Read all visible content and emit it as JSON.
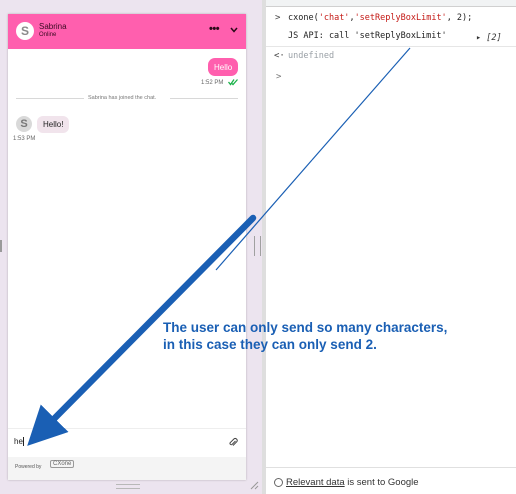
{
  "chat": {
    "agent_initial": "S",
    "agent_name": "Sabrina",
    "agent_status": "Online",
    "menu_label": "•••",
    "messages": {
      "out_text": "Hello",
      "out_time": "1:52 PM",
      "system_text": "Sabrina has joined the chat.",
      "in_avatar": "S",
      "in_text": "Hello!",
      "in_time": "1:53 PM"
    },
    "input_value": "he",
    "powered_by": "Powered by",
    "logo_text": "CXone"
  },
  "console": {
    "line1_prefix": ">",
    "line1_code": "cxone('chat','setReplyBoxLimit', 2);",
    "line2_code": "JS API: call 'setReplyBoxLimit'",
    "line2_array": "▸ [2]",
    "line3_prefix": "<·",
    "line3_value": "undefined",
    "line4_prefix": ">",
    "footer_link": "Relevant data",
    "footer_rest": " is sent to Google"
  },
  "annotation": {
    "line1": "The user can only send so many characters,",
    "line2": "in this case they can only send 2.",
    "color": "#1a5fb4"
  },
  "colors": {
    "chat_header": "#ff5fae",
    "incoming_bubble": "#f1e4ec"
  },
  "icons": [
    "chevron-down-icon",
    "double-check-icon",
    "paperclip-icon",
    "resize-corner-icon",
    "radio-icon"
  ]
}
